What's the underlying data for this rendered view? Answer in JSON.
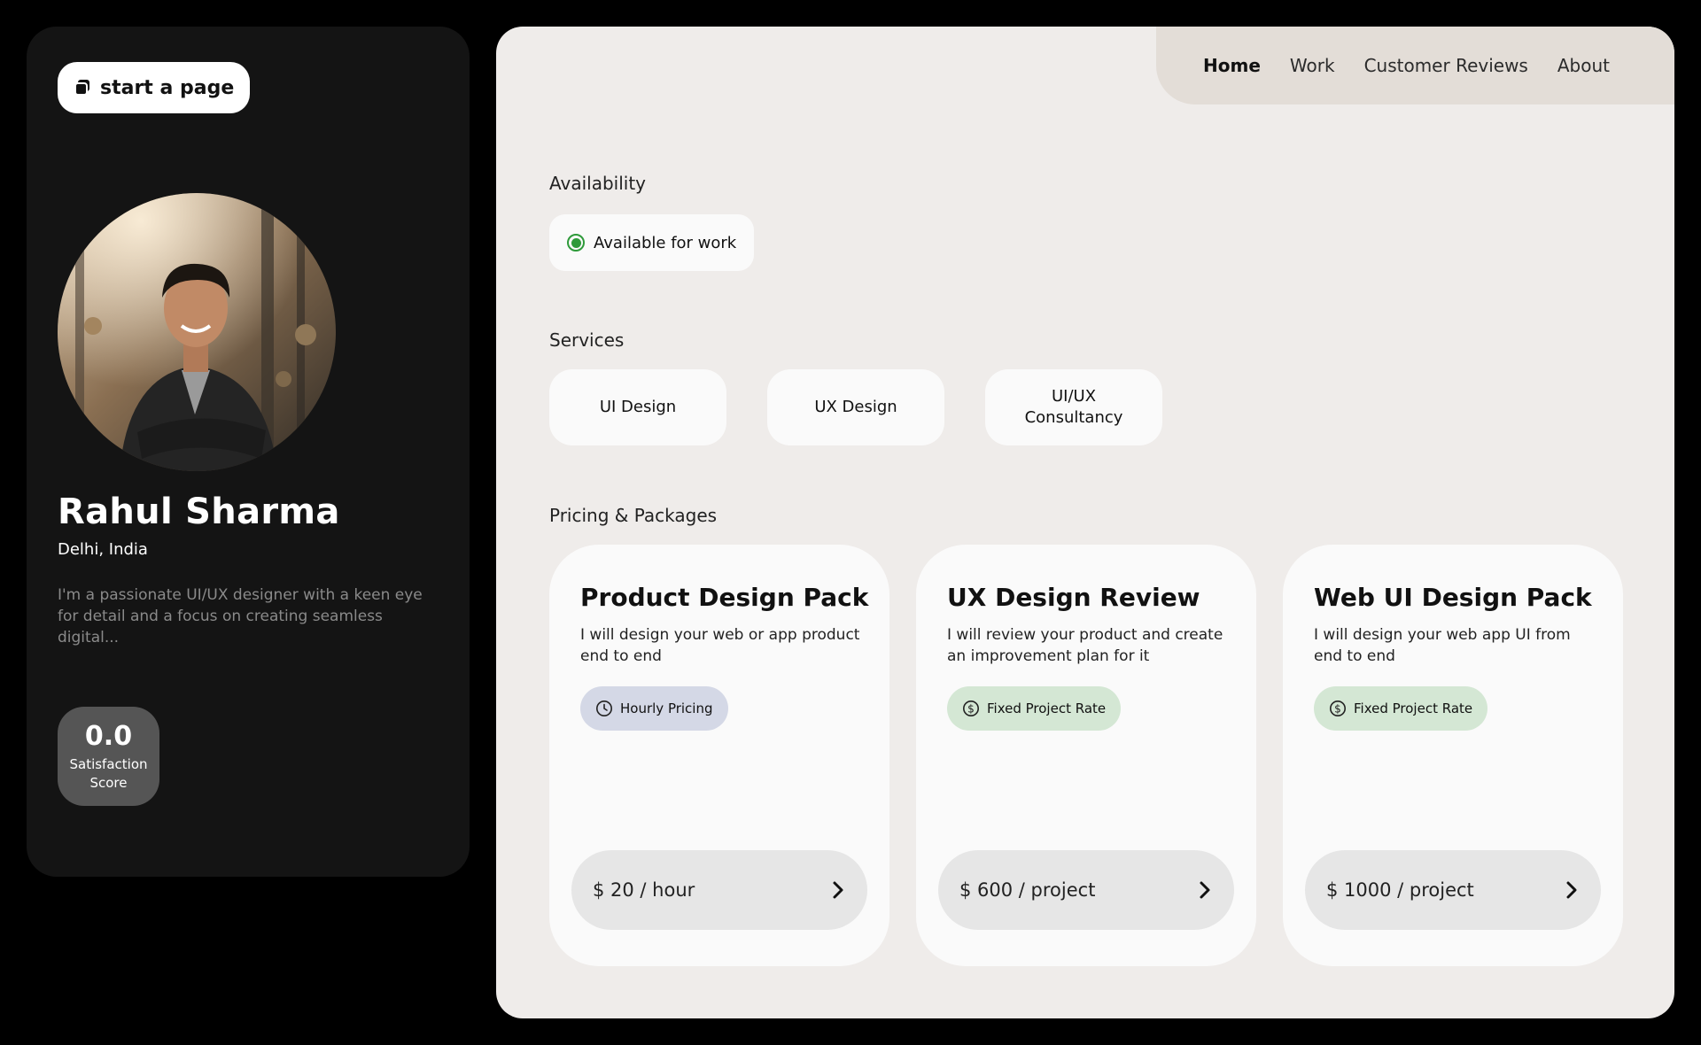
{
  "profile": {
    "start_button_label": "start a page",
    "name": "Rahul Sharma",
    "location": "Delhi, India",
    "bio": "I'm a passionate UI/UX designer with a keen eye for detail and a focus on creating seamless digital...",
    "score_value": "0.0",
    "score_label": "Satisfaction Score"
  },
  "nav": {
    "items": [
      {
        "label": "Home",
        "active": true
      },
      {
        "label": "Work"
      },
      {
        "label": "Customer Reviews"
      },
      {
        "label": "About"
      }
    ]
  },
  "availability": {
    "heading": "Availability",
    "status": "Available for work",
    "status_color": "#2e9a3a"
  },
  "services": {
    "heading": "Services",
    "items": [
      "UI Design",
      "UX Design",
      "UI/UX Consultancy"
    ]
  },
  "pricing": {
    "heading": "Pricing & Packages",
    "packages": [
      {
        "title": "Product Design Pack",
        "description": "I will design your web or app product end to end",
        "tag": "Hourly Pricing",
        "tag_icon": "clock-icon",
        "price": "$ 20 / hour"
      },
      {
        "title": "UX Design Review",
        "description": "I will review your product and create an improvement plan for it",
        "tag": "Fixed Project Rate",
        "tag_icon": "dollar-circle-icon",
        "price": "$ 600 / project"
      },
      {
        "title": "Web UI Design Pack",
        "description": "I will design your web app UI from end to end",
        "tag": "Fixed Project Rate",
        "tag_icon": "dollar-circle-icon",
        "price": "$ 1000 / project"
      }
    ]
  },
  "colors": {
    "page_bg": "#000000",
    "profile_bg": "#141414",
    "main_bg": "#efecea",
    "nav_bg": "#e3ddd7",
    "hourly_tag": "#d4d8e6",
    "fixed_tag": "#d4e7d4"
  }
}
